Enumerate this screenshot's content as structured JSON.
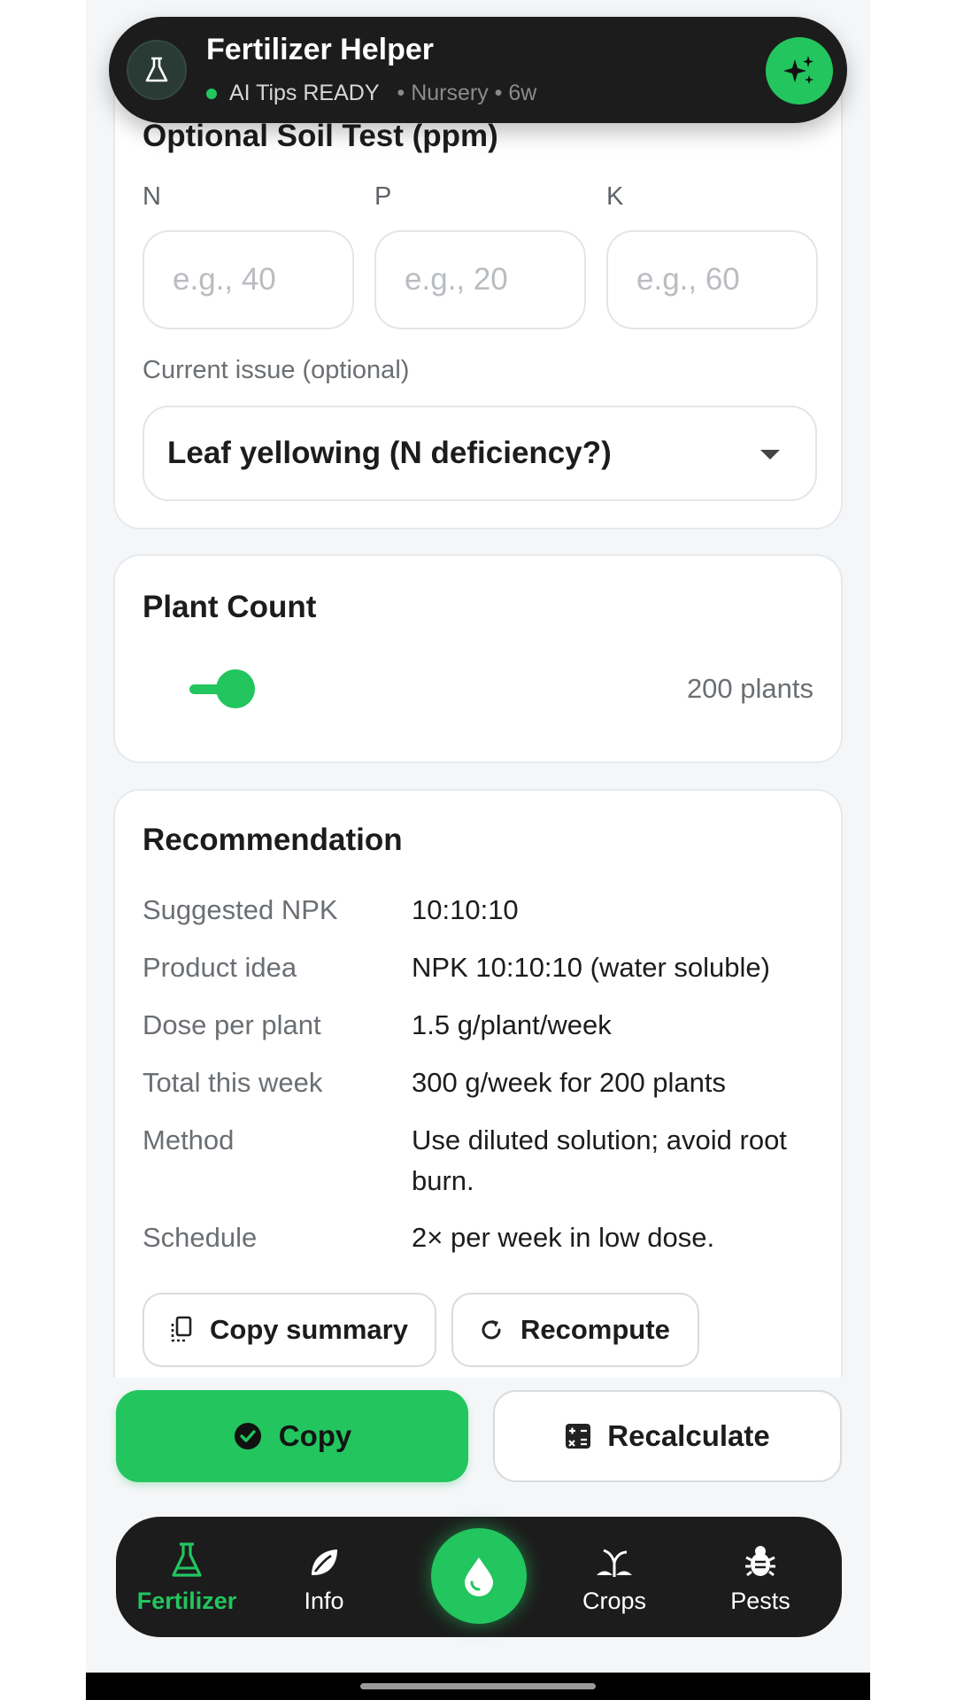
{
  "header": {
    "title": "Fertilizer Helper",
    "status": "AI Tips READY",
    "context": "• Nursery • 6w"
  },
  "soil_test": {
    "title": "Optional Soil Test (ppm)",
    "n_label": "N",
    "p_label": "P",
    "k_label": "K",
    "n_placeholder": "e.g., 40",
    "p_placeholder": "e.g., 20",
    "k_placeholder": "e.g., 60",
    "issue_label": "Current issue (optional)",
    "issue_value": "Leaf yellowing (N deficiency?)"
  },
  "plant_count": {
    "title": "Plant Count",
    "value_text": "200 plants"
  },
  "recommendation": {
    "title": "Recommendation",
    "rows": [
      {
        "key": "Suggested NPK",
        "value": "10:10:10"
      },
      {
        "key": "Product idea",
        "value": "NPK 10:10:10 (water soluble)"
      },
      {
        "key": "Dose per plant",
        "value": "1.5 g/plant/week"
      },
      {
        "key": "Total this week",
        "value": "300 g/week for 200 plants"
      },
      {
        "key": "Method",
        "value": "Use diluted solution; avoid root burn."
      },
      {
        "key": "Schedule",
        "value": "2× per week in low dose."
      }
    ],
    "copy_summary_label": "Copy summary",
    "recompute_label": "Recompute"
  },
  "actions": {
    "copy_label": "Copy",
    "recalculate_label": "Recalculate"
  },
  "nav": {
    "items": [
      {
        "label": "Fertilizer",
        "icon": "flask-icon",
        "active": true
      },
      {
        "label": "Info",
        "icon": "leaf-icon",
        "active": false
      },
      {
        "label": "Crops",
        "icon": "sprout-icon",
        "active": false
      },
      {
        "label": "Pests",
        "icon": "bug-icon",
        "active": false
      }
    ],
    "center_icon": "water-drop-icon"
  },
  "colors": {
    "accent": "#22c55e",
    "dark": "#1c1c1c",
    "background": "#f4f6f8"
  }
}
